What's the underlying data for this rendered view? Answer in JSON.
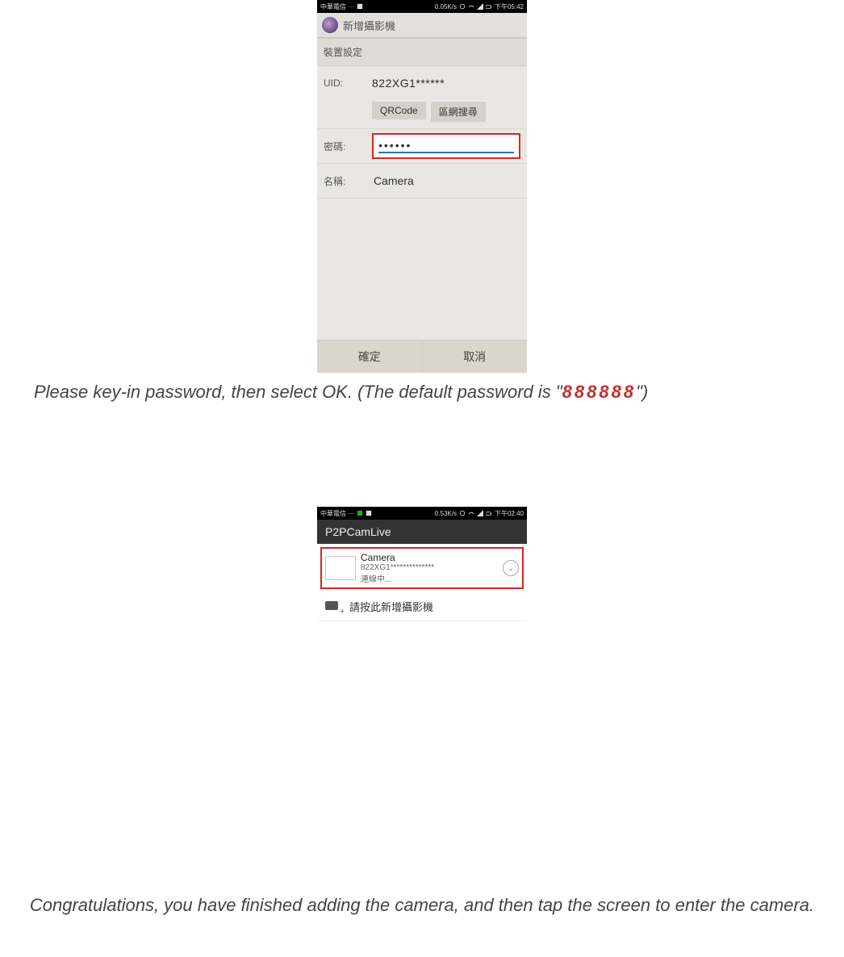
{
  "phone1": {
    "statusbar": {
      "carrier": "中華電信 ···",
      "net": "0.05K/s",
      "time": "下午05:42"
    },
    "title": "新增攝影機",
    "section": "裝置設定",
    "uid_label": "UID:",
    "uid_value": "822XG1******",
    "qr_btn": "QRCode",
    "lan_btn": "區網搜尋",
    "pw_label": "密碼:",
    "pw_value": "••••••",
    "name_label": "名稱:",
    "name_value": "Camera",
    "ok": "確定",
    "cancel": "取消"
  },
  "caption1": {
    "pre": "Please key-in password, then select OK. (The default password is \"",
    "pw": "888888",
    "post": "\")"
  },
  "phone2": {
    "statusbar": {
      "carrier": "中華電信 ···",
      "net": "0.53K/s",
      "time": "下午02:40"
    },
    "title": "P2PCamLive",
    "cam_name": "Camera",
    "cam_uid": "822XG1**************",
    "cam_status": "連線中...",
    "add_label": "請按此新增攝影機"
  },
  "caption2": "Congratulations, you have finished adding the camera, and then tap the screen to enter the camera."
}
